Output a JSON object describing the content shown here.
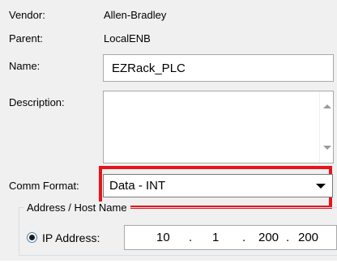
{
  "fields": {
    "vendor_label": "Vendor:",
    "vendor_value": "Allen-Bradley",
    "parent_label": "Parent:",
    "parent_value": "LocalENB",
    "name_label": "Name:",
    "name_value": "EZRack_PLC",
    "description_label": "Description:",
    "description_value": "",
    "comm_format_label": "Comm Format:",
    "comm_format_value": "Data - INT"
  },
  "address_group": {
    "title": "Address / Host Name",
    "ip_label": "IP Address:",
    "ip_octets": [
      "10",
      "1",
      "200",
      "200"
    ],
    "ip_separator": "."
  },
  "colors": {
    "highlight": "#e8141c",
    "dialog_background": "#f0f0f0"
  },
  "icons": {
    "description_scroll_up": "scroll-up-arrow-icon",
    "description_scroll_down": "scroll-down-arrow-icon",
    "comm_format_dropdown": "chevron-down-icon"
  }
}
